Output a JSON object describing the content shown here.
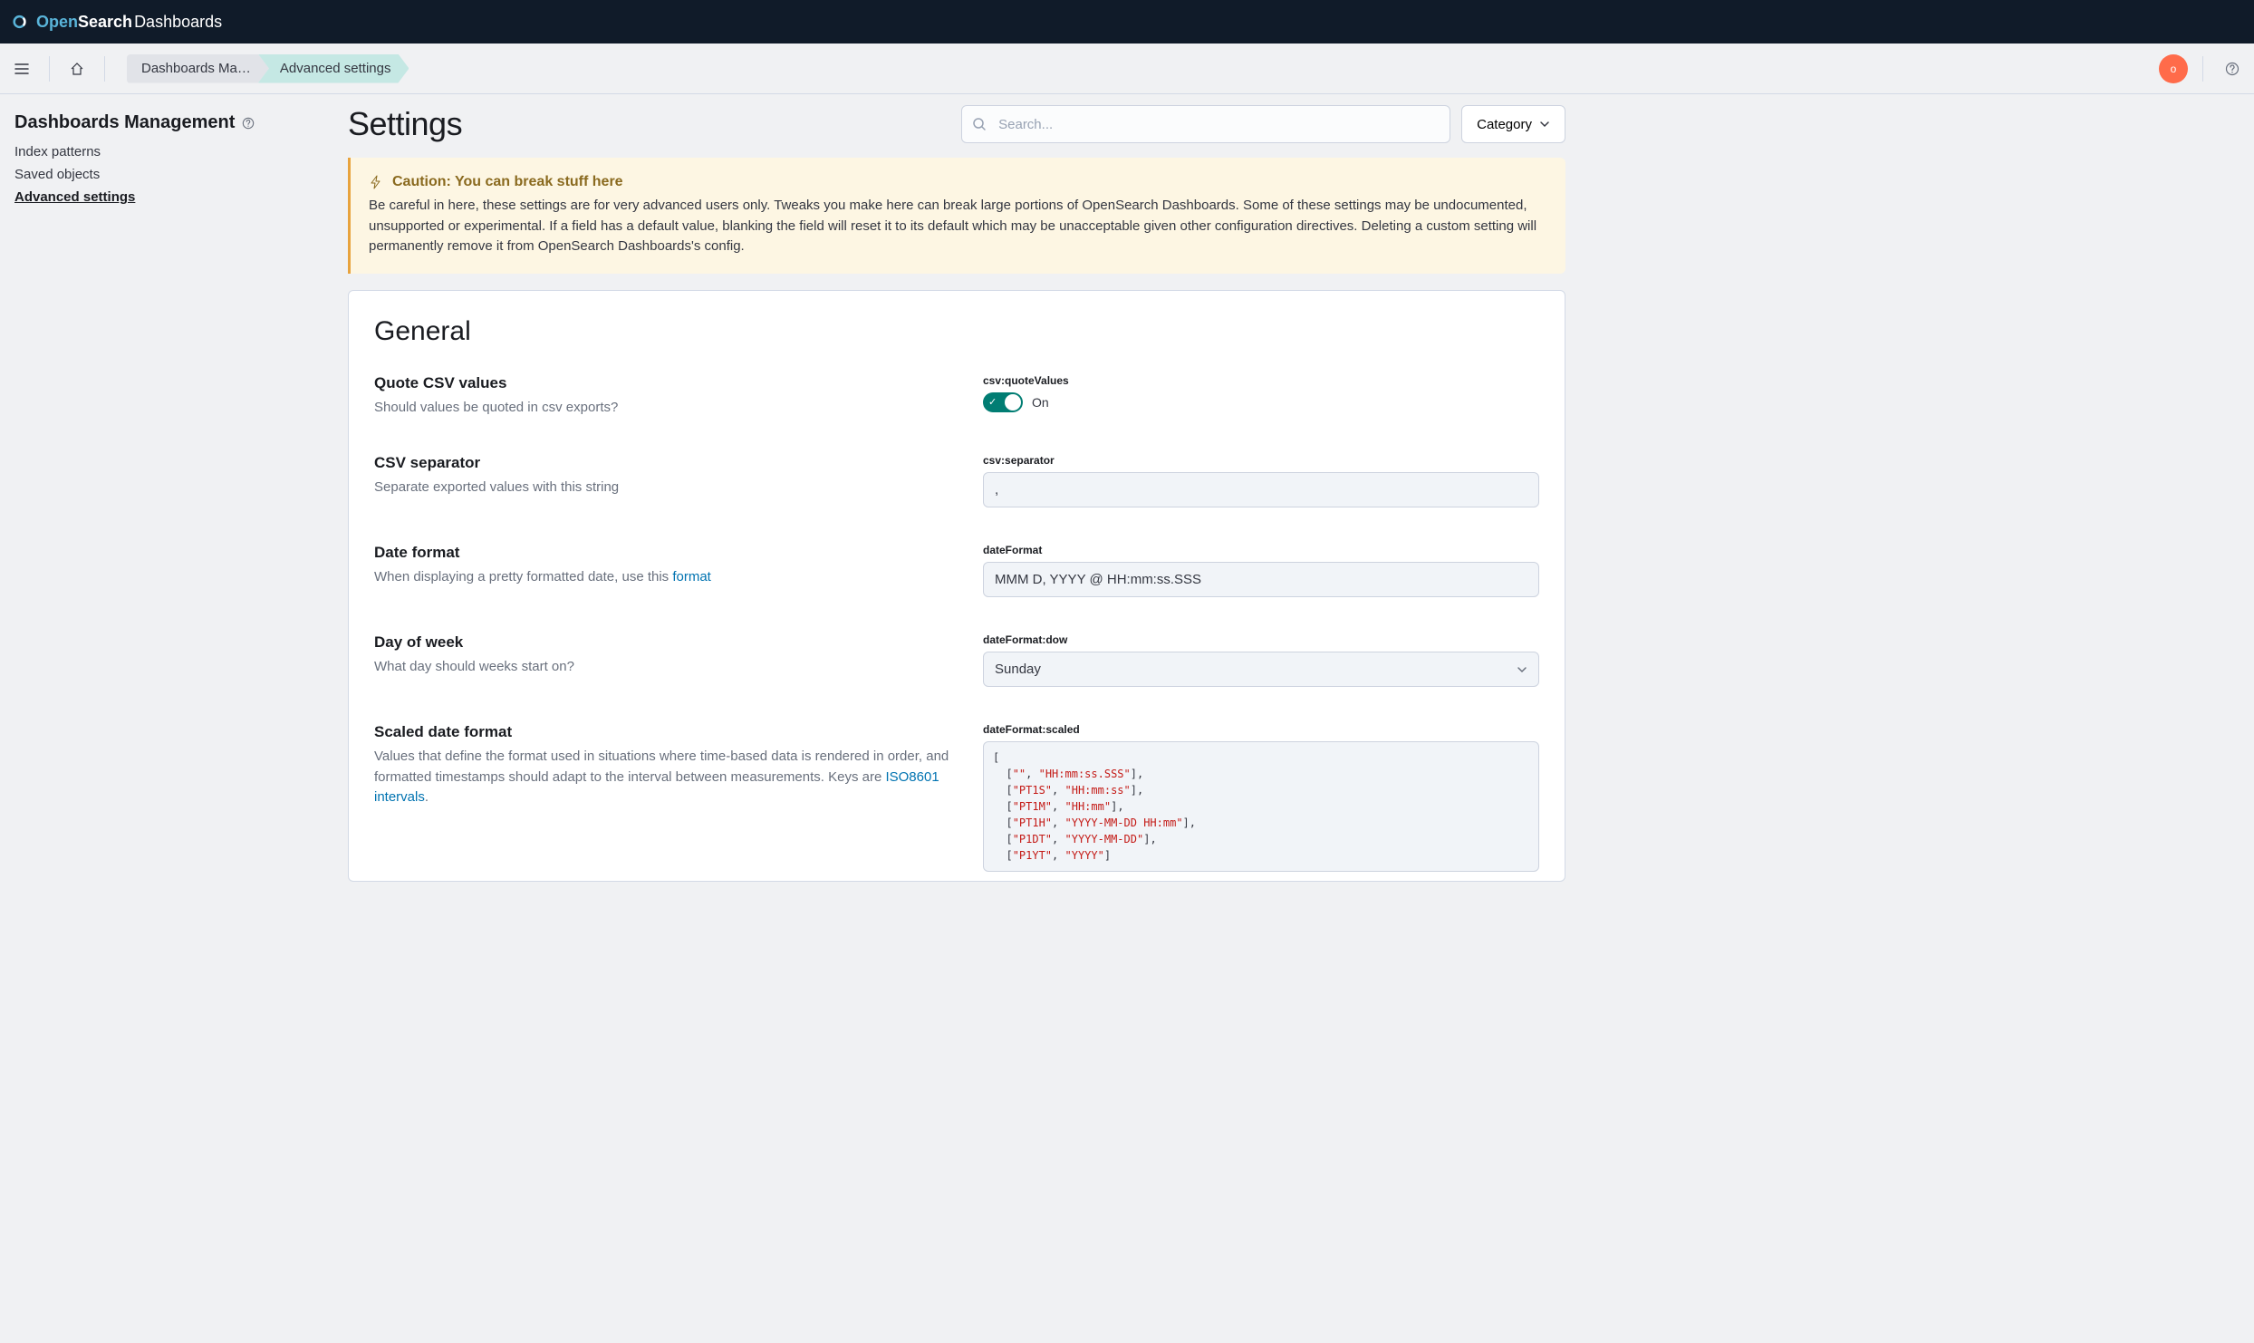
{
  "brand": {
    "open": "Open",
    "search": "Search",
    "dashboards": "Dashboards"
  },
  "breadcrumbs": {
    "first": "Dashboards Ma…",
    "second": "Advanced settings"
  },
  "avatar_letter": "o",
  "sidebar": {
    "title": "Dashboards Management",
    "items": [
      "Index patterns",
      "Saved objects",
      "Advanced settings"
    ],
    "active_index": 2
  },
  "page": {
    "title": "Settings",
    "search_placeholder": "Search...",
    "category_label": "Category"
  },
  "callout": {
    "title": "Caution: You can break stuff here",
    "body": "Be careful in here, these settings are for very advanced users only. Tweaks you make here can break large portions of OpenSearch Dashboards. Some of these settings may be undocumented, unsupported or experimental. If a field has a default value, blanking the field will reset it to its default which may be unacceptable given other configuration directives. Deleting a custom setting will permanently remove it from OpenSearch Dashboards's config."
  },
  "section_title": "General",
  "settings": {
    "csv_quote": {
      "title": "Quote CSV values",
      "desc": "Should values be quoted in csv exports?",
      "field": "csv:quoteValues",
      "value_label": "On"
    },
    "csv_sep": {
      "title": "CSV separator",
      "desc": "Separate exported values with this string",
      "field": "csv:separator",
      "value": ","
    },
    "date_format": {
      "title": "Date format",
      "desc_pre": "When displaying a pretty formatted date, use this ",
      "desc_link": "format",
      "field": "dateFormat",
      "value": "MMM D, YYYY @ HH:mm:ss.SSS"
    },
    "dow": {
      "title": "Day of week",
      "desc": "What day should weeks start on?",
      "field": "dateFormat:dow",
      "value": "Sunday"
    },
    "scaled": {
      "title": "Scaled date format",
      "desc_pre": "Values that define the format used in situations where time-based data is rendered in order, and formatted timestamps should adapt to the interval between measurements. Keys are ",
      "desc_link": "ISO8601 intervals",
      "desc_post": ".",
      "field": "dateFormat:scaled",
      "value_rows": [
        [
          "",
          "HH:mm:ss.SSS"
        ],
        [
          "PT1S",
          "HH:mm:ss"
        ],
        [
          "PT1M",
          "HH:mm"
        ],
        [
          "PT1H",
          "YYYY-MM-DD HH:mm"
        ],
        [
          "P1DT",
          "YYYY-MM-DD"
        ],
        [
          "P1YT",
          "YYYY"
        ]
      ]
    }
  }
}
